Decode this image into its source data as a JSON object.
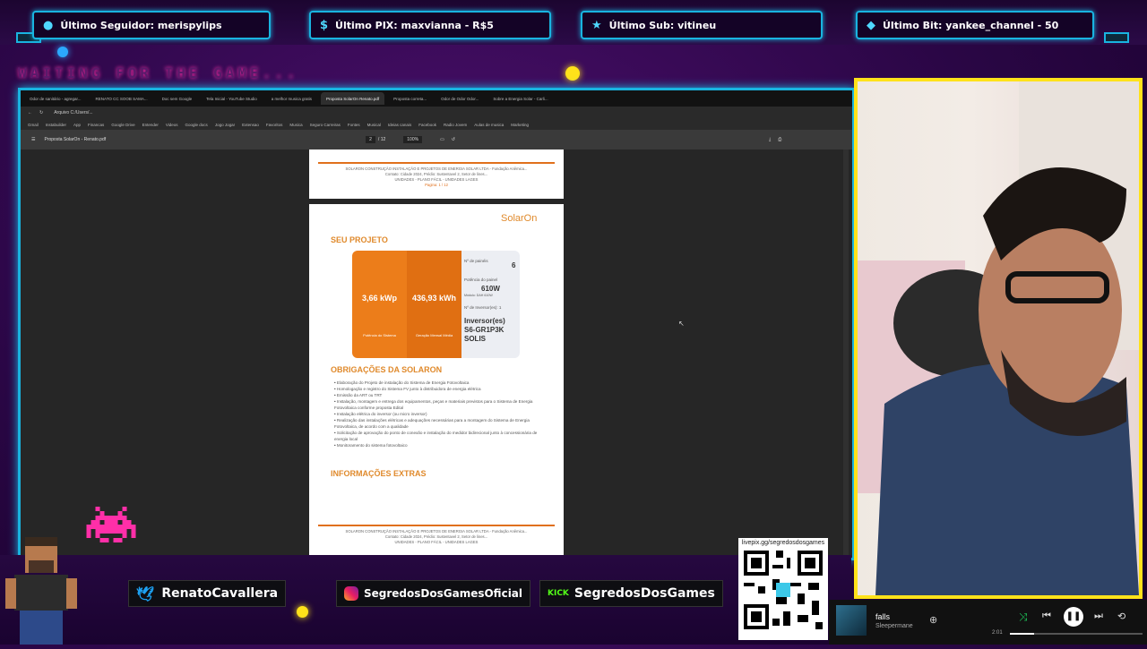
{
  "alerts": {
    "follower": "Último Seguidor: merispylips",
    "pix": "Último PIX: maxvianna - R$5",
    "sub": "Último Sub: vitineu",
    "bit": "Último Bit: yankee_channel - 50"
  },
  "waiting_text": "WAITING FOR THE GAME...",
  "browser": {
    "tabs": [
      "Odor de sanitário - agregar...",
      "RENATO CC SOOB SAMA...",
      "Doc sem Google",
      "Tela Inicial - YouTube Studio",
      "a melhor musica gratis",
      "Proposta SolarOn Renato.pdf",
      "Proposta correta...",
      "Odor de Odor Odor...",
      "Sobre a Energia Solar - Carli..."
    ],
    "address": "Arquivo   C:/Users/...",
    "bookmarks": [
      "Gmail",
      "Instabuilder",
      "App",
      "Financas",
      "Google Drive",
      "Entender",
      "Videos",
      "Google docs",
      "Jogo Jogar",
      "Extensao",
      "Favoritos",
      "Musica",
      "Seguro Carreiras",
      "Fontes",
      "Musical",
      "Ideias canais",
      "Facebook",
      "Radio Jovem",
      "Aulas de musica",
      "Marketing"
    ],
    "pdf_title": "Proposta SolarOn - Renato.pdf",
    "page_number": "2",
    "page_total": "/ 12",
    "zoom": "100%"
  },
  "pdf": {
    "prev_page_lines": [
      "SOLARON CONSTRUÇÃO INSTALAÇÃO E PROJETOS DE ENERGIA SOLAR LTDA - Fundação Anêmica...",
      "Contato: Cidade 2024, Prédio: Sustentavel 2, Setor de lines...",
      "UNIDADES - PLANO FÁCIL - UNIDADES LAGES",
      "Pagina: 1 / 12"
    ],
    "logo": "SolarOn",
    "section_projeto": "SEU PROJETO",
    "potencia_value": "3,66 kWp",
    "potencia_label": "Potência do Sistema",
    "geracao_value": "436,93 kWh",
    "geracao_label": "Geração Mensal Média",
    "modules_label": "Nº de painéis",
    "modules_value": "6",
    "module_power_label": "Potência do painel",
    "module_power_value": "610W",
    "module_model": "Módulo: DAH 610W",
    "inverter_label": "Nº de Inversor(es): 1",
    "inverter_value": "Inversor(es) S6-GR1P3K SOLIS",
    "section_obrigacoes": "OBRIGAÇÕES DA SOLARON",
    "obrigacoes": [
      "Elaboração do Projeto de instalação do Sistema de Energia Fotovoltaica",
      "Homologação e registro do Sistema FV junto à distribuidora de energia elétrica",
      "Emissão da ART ou TRT",
      "Instalação, montagem e entrega dos equipamentos, peças e materiais previstos para o Sistema de Energia Fotovoltaica conforme proposta Edital",
      "Instalação elétrica do inversor (ou micro inversor)",
      "Realização das instalações elétricas e adequações necessárias para a montagem do Sistema de Energia Fotovoltaica, de acordo com a qualidade",
      "Solicitação de aprovação do ponto de conexão e instalação do medidor bidirecional junto à concessionária de energia local",
      "Monitoramento do sistema fotovoltaico"
    ],
    "section_extras": "INFORMAÇÕES EXTRAS",
    "footer_lines": [
      "SOLARON CONSTRUÇÃO INSTALAÇÃO E PROJETOS DE ENERGIA SOLAR LTDA - Fundação Anêmica...",
      "Contato: Cidade 2024, Prédio: Sustentavel 2, Setor de lines...",
      "UNIDADES - PLANO FÁCIL - UNIDADES LAGES"
    ]
  },
  "socials": {
    "twitter": "RenatoCavallera",
    "instagram": "SegredosDosGamesOficial",
    "kick_badge": "KICK",
    "kick": "SegredosDosGames"
  },
  "qr": {
    "url": "livepix.gg/segredosdosgames"
  },
  "player": {
    "track": "falls",
    "artist": "Sleepermane",
    "time": "2:01"
  },
  "colors": {
    "neon_blue": "#19b4e0",
    "neon_yellow": "#ffe21a",
    "orange": "#e0701c"
  }
}
